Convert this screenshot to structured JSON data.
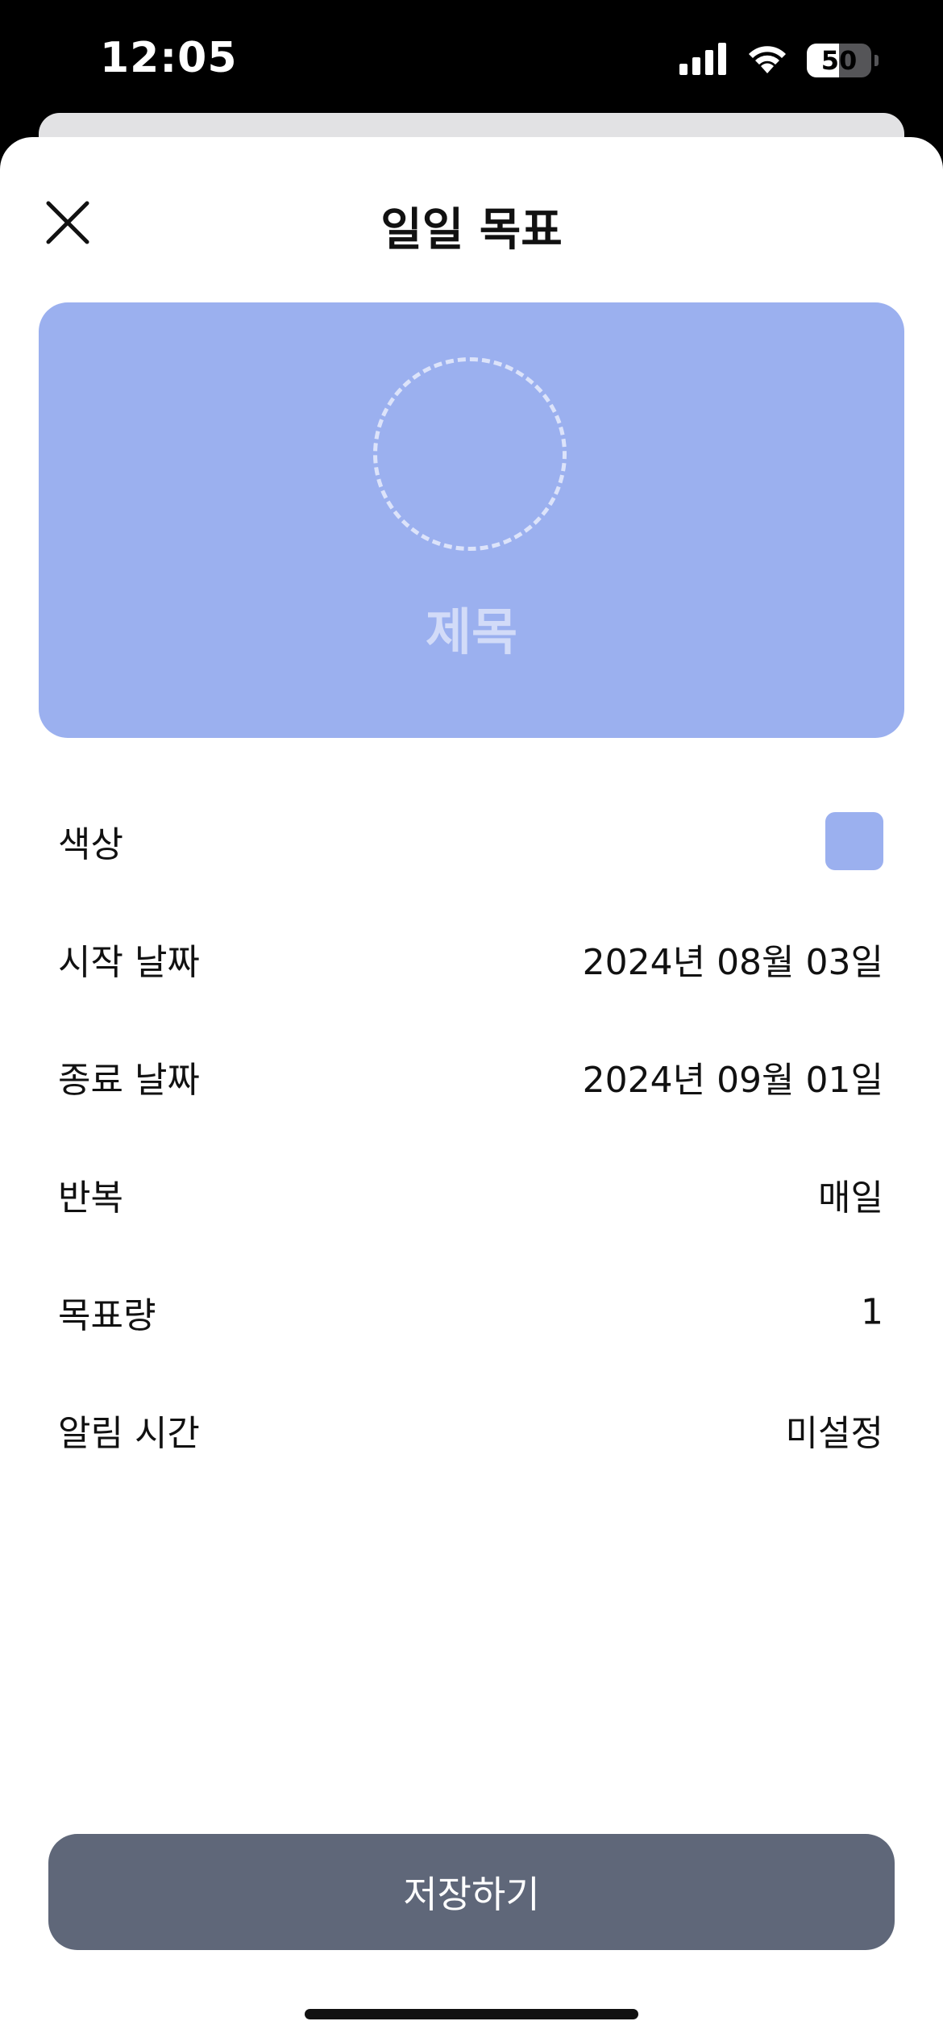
{
  "status_bar": {
    "time": "12:05",
    "battery_level": "50",
    "battery_fraction": 0.5,
    "icons": [
      "signal-icon",
      "wifi-icon",
      "battery-icon"
    ]
  },
  "header": {
    "title": "일일 목표",
    "close_icon": "close-icon"
  },
  "preview": {
    "icon_placeholder": "dashed-circle-icon",
    "title_placeholder": "제목",
    "background_color": "#9bb0ef"
  },
  "settings": {
    "color": {
      "label": "색상",
      "swatch_color": "#9bb0ef"
    },
    "start_date": {
      "label": "시작 날짜",
      "value": "2024년 08월 03일"
    },
    "end_date": {
      "label": "종료 날짜",
      "value": "2024년 09월 01일"
    },
    "repeat": {
      "label": "반복",
      "value": "매일"
    },
    "target_amount": {
      "label": "목표량",
      "value": "1"
    },
    "alarm_time": {
      "label": "알림 시간",
      "value": "미설정"
    }
  },
  "save_button": {
    "label": "저장하기",
    "background_color": "#5f6779"
  }
}
